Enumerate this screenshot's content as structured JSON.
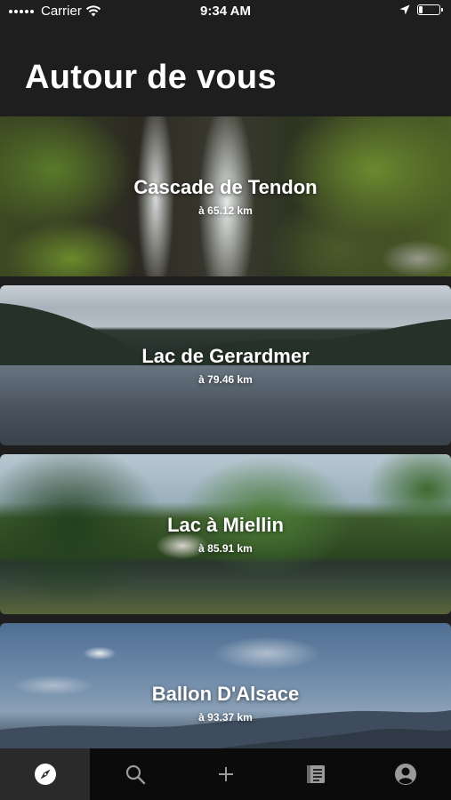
{
  "status": {
    "carrier": "Carrier",
    "time": "9:34 AM",
    "battery_level": 0.2
  },
  "page": {
    "title": "Autour de vous"
  },
  "places": [
    {
      "name": "Cascade de Tendon",
      "distance": "à 65.12 km"
    },
    {
      "name": "Lac de Gerardmer",
      "distance": "à 79.46 km"
    },
    {
      "name": "Lac à Miellin",
      "distance": "à 85.91 km"
    },
    {
      "name": "Ballon D'Alsace",
      "distance": "à 93.37 km"
    }
  ],
  "tabs": [
    {
      "icon": "compass-icon",
      "active": true
    },
    {
      "icon": "search-icon",
      "active": false
    },
    {
      "icon": "plus-icon",
      "active": false
    },
    {
      "icon": "book-icon",
      "active": false
    },
    {
      "icon": "profile-icon",
      "active": false
    }
  ],
  "colors": {
    "background": "#1e1e1e",
    "tab_bar": "#0b0b0b",
    "active_tab": "#2a2a2a",
    "text": "#ffffff"
  }
}
